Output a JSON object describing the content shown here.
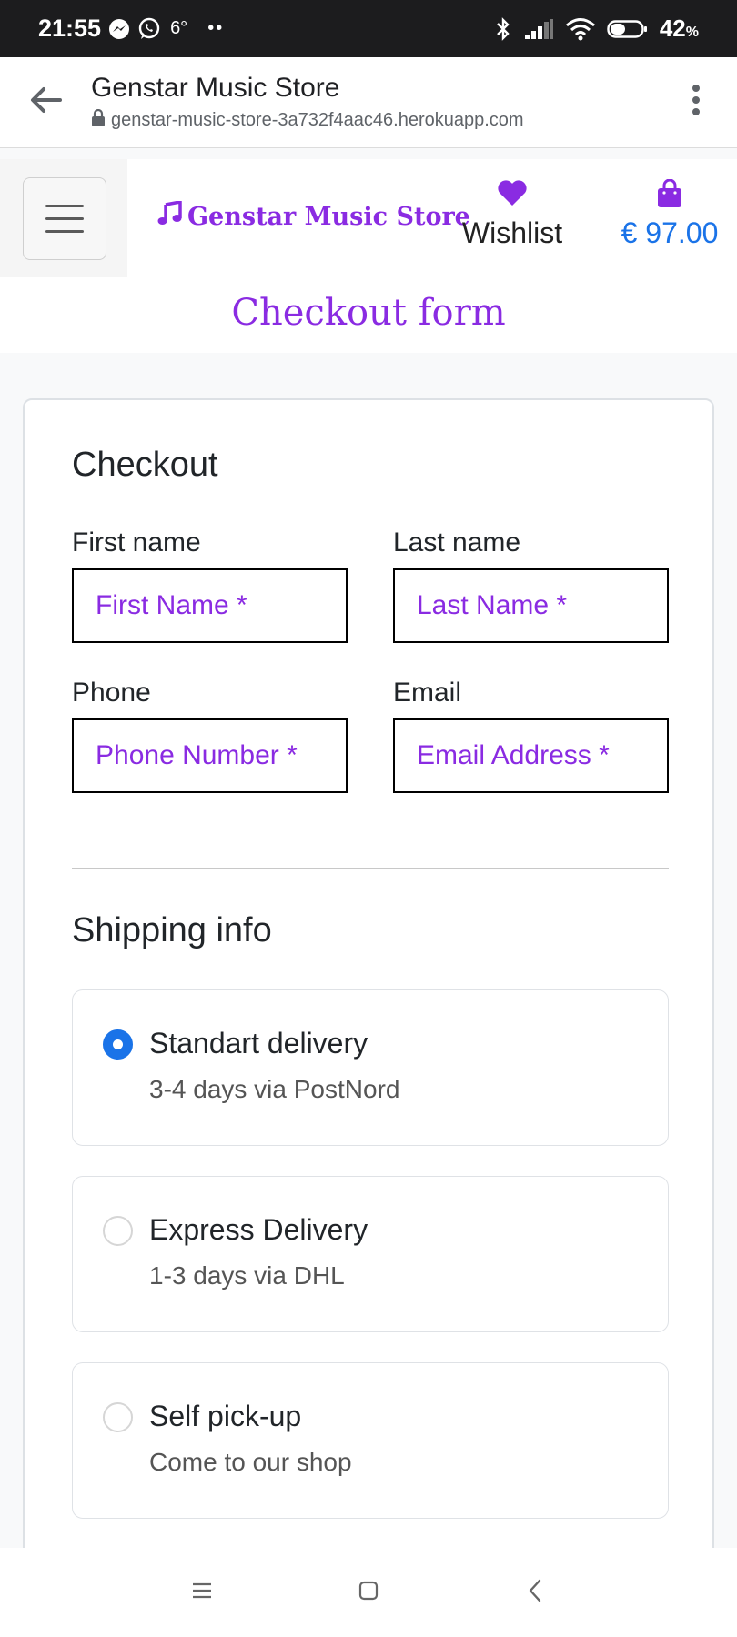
{
  "status_bar": {
    "time": "21:55",
    "temperature": "6°",
    "dots": "••",
    "battery": "42",
    "battery_unit": "%"
  },
  "browser": {
    "title": "Genstar Music Store",
    "url": "genstar-music-store-3a732f4aac46.herokuapp.com"
  },
  "navbar": {
    "brand": "Genstar Music Store",
    "wishlist_label": "Wishlist",
    "cart_total": "€ 97.00",
    "accent_color": "#8a2be2",
    "link_color": "#1a73e8"
  },
  "page": {
    "heading": "Checkout form"
  },
  "checkout": {
    "title": "Checkout",
    "first_name": {
      "label": "First name",
      "placeholder": "First Name *"
    },
    "last_name": {
      "label": "Last name",
      "placeholder": "Last Name *"
    },
    "phone": {
      "label": "Phone",
      "placeholder": "Phone Number *"
    },
    "email": {
      "label": "Email",
      "placeholder": "Email Address *"
    }
  },
  "shipping": {
    "title": "Shipping info",
    "options": [
      {
        "title": "Standart delivery",
        "subtitle": "3-4 days via PostNord",
        "selected": true
      },
      {
        "title": "Express Delivery",
        "subtitle": "1-3 days via DHL",
        "selected": false
      },
      {
        "title": "Self pick-up",
        "subtitle": "Come to our shop",
        "selected": false
      }
    ]
  },
  "icons": {
    "status": [
      "messenger-icon",
      "whatsapp-icon",
      "bluetooth-icon",
      "signal-icon",
      "wifi-icon",
      "battery-icon"
    ],
    "browser": [
      "back-arrow-icon",
      "lock-icon",
      "more-vert-icon"
    ],
    "navbar": [
      "hamburger-icon",
      "music-note-icon",
      "heart-icon",
      "shopping-bag-icon"
    ],
    "system_nav": [
      "recents-icon",
      "home-icon",
      "back-icon"
    ]
  }
}
